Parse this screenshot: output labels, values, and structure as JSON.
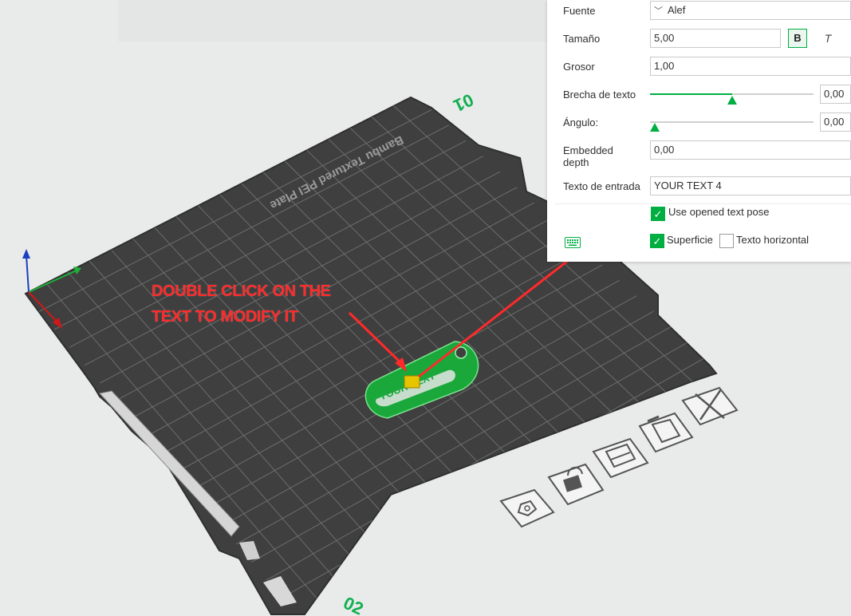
{
  "viewport": {
    "plate_label": "Bambu Textured PEI Plate",
    "plate_number": "01",
    "plate_number_bottom": "02",
    "model_text": "YOUR TEXT"
  },
  "annotation": {
    "text": "DOUBLE CLICK ON THE\nTEXT TO  MODIFY IT"
  },
  "text_panel": {
    "font": {
      "label": "Fuente",
      "value": "Alef"
    },
    "size": {
      "label": "Tamaño",
      "value": "5,00",
      "bold_label": "B",
      "italic_label": "T"
    },
    "thickness": {
      "label": "Grosor",
      "value": "1,00"
    },
    "text_gap": {
      "label": "Brecha de texto",
      "value": "0,00",
      "slider_level": 0.5
    },
    "angle": {
      "label": "Ángulo:",
      "value": "0,00",
      "slider_level": 0.0
    },
    "embedded_depth": {
      "label": "Embedded\ndepth",
      "value": "0,00"
    },
    "input_text": {
      "label": "Texto de entrada",
      "value": "YOUR TEXT 4"
    },
    "use_opened_text_pose": {
      "label": "Use opened text pose",
      "checked": true
    },
    "surface": {
      "label": "Superficie",
      "checked": true
    },
    "horizontal_text": {
      "label": "Texto horizontal",
      "checked": false
    }
  },
  "plate_toolbar": {
    "icons": [
      "settings-hex-icon",
      "lock-icon",
      "arrange-icon",
      "auto-orient-icon",
      "delete-plate-icon"
    ]
  },
  "colors": {
    "plate": "#3f3f3f",
    "accent": "#00ae42",
    "annotation": "#ff2a2a",
    "background": "#e9eaea"
  }
}
